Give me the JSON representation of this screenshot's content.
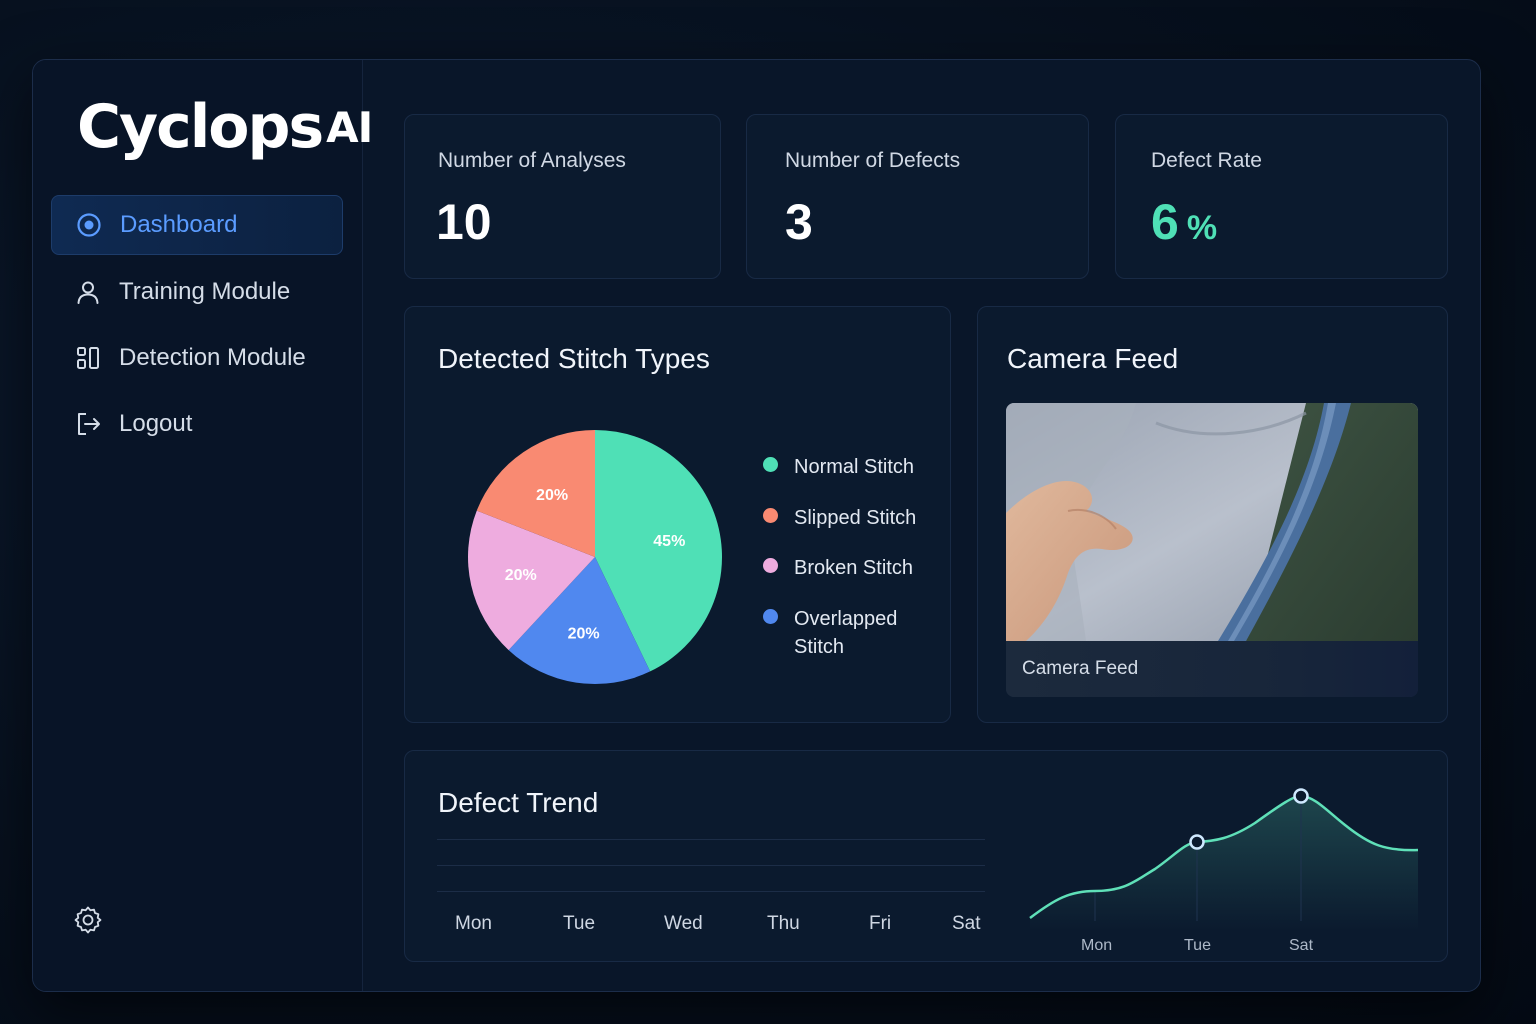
{
  "brand": {
    "name": "Cyclops",
    "suffix": "AI"
  },
  "nav": [
    {
      "label": "Dashboard",
      "icon": "target-icon",
      "active": true
    },
    {
      "label": "Training Module",
      "icon": "user-icon",
      "active": false
    },
    {
      "label": "Detection Module",
      "icon": "grid-icon",
      "active": false
    },
    {
      "label": "Logout",
      "icon": "logout-icon",
      "active": false
    }
  ],
  "stats": [
    {
      "label": "Number of Analyses",
      "value": "10"
    },
    {
      "label": "Number of Defects",
      "value": "3"
    },
    {
      "label": "Defect Rate",
      "value": "6",
      "unit": "%"
    }
  ],
  "stitch_card": {
    "title": "Detected Stitch Types"
  },
  "chart_data": [
    {
      "type": "pie",
      "title": "Detected Stitch Types",
      "categories": [
        "Normal Stitch",
        "Slipped Stitch",
        "Broken Stitch",
        "Overlapped Stitch"
      ],
      "values": [
        45,
        20,
        20,
        20
      ],
      "labels": [
        "45%",
        "20%",
        "20%",
        "20%"
      ],
      "colors": [
        "#4fe0b6",
        "#f98a72",
        "#eeacdf",
        "#5088ef"
      ],
      "legend": "right"
    },
    {
      "type": "line",
      "title": "Defect Trend",
      "x": [
        "Mon",
        "Tue",
        "Wed",
        "Thu",
        "Fri",
        "Sat"
      ],
      "mini_x_labels": [
        "Mon",
        "Tue",
        "Sat"
      ],
      "color": "#5fe0b8"
    }
  ],
  "camera": {
    "title": "Camera Feed",
    "caption": "Camera Feed"
  },
  "trend": {
    "title": "Defect Trend",
    "days": [
      "Mon",
      "Tue",
      "Wed",
      "Thu",
      "Fri",
      "Sat"
    ],
    "mini_days": [
      "Mon",
      "Tue",
      "Sat"
    ]
  }
}
